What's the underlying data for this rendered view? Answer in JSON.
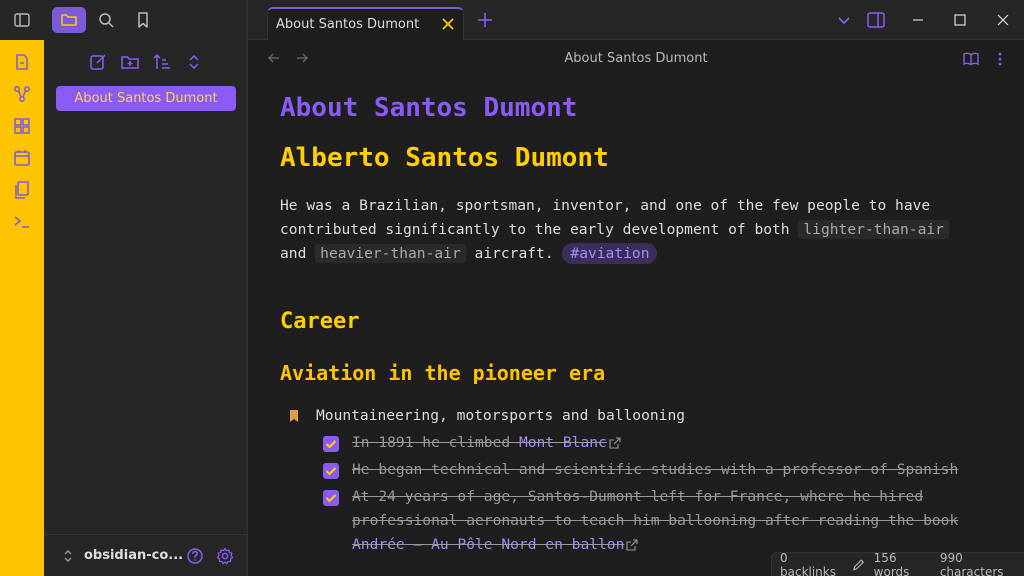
{
  "tab": {
    "title": "About Santos Dumont"
  },
  "sidebar": {
    "file_item": "About Santos Dumont",
    "vault_name": "obsidian-co..."
  },
  "nav": {
    "title": "About Santos Dumont"
  },
  "doc": {
    "title": "About Santos Dumont",
    "h1": "Alberto Santos Dumont",
    "para": {
      "text1": "He was a Brazilian, sportsman, inventor, and one of the few people to have contributed significantly to the early development of both ",
      "code1": "lighter-than-air",
      "text2": " and ",
      "code2": "heavier-than-air",
      "text3": " aircraft. ",
      "tag": "#aviation"
    },
    "h2": "Career",
    "h3": "Aviation in the pioneer era",
    "list": {
      "item": "Mountaineering, motorsports and ballooning",
      "task1_pre": "In 1891 he climbed ",
      "task1_link": "Mont Blanc",
      "task2": "He began technical and scientific studies with a professor of Spanish",
      "task3": "At 24 years of age, Santos-Dumont left for France, where he hired professional aeronauts to teach him ballooning after reading the book ",
      "task3_link": "Andrée – Au Pôle Nord en ballon"
    }
  },
  "status": {
    "backlinks": "0 backlinks",
    "words": "156 words",
    "characters": "990 characters"
  },
  "colors": {
    "accent": "#8a5cf5",
    "ribbon": "#ffc400",
    "heading": "#ffd000"
  }
}
